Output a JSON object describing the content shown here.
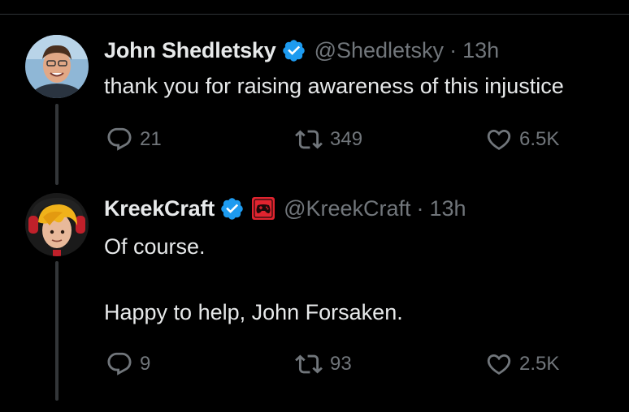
{
  "colors": {
    "background": "#000000",
    "primary_text": "#e7e9ea",
    "secondary_text": "#71767b",
    "verified_blue": "#1d9bf0",
    "thread_line": "#333639",
    "affiliate_badge_red": "#e0242f"
  },
  "tweets": [
    {
      "display_name": "John Shedletsky",
      "verified_icon": "verified-badge-icon",
      "handle": "@Shedletsky",
      "separator": "·",
      "time": "13h",
      "text_lines": [
        "thank you for raising awareness of this injustice"
      ],
      "actions": {
        "replies": "21",
        "retweets": "349",
        "likes": "6.5K"
      }
    },
    {
      "display_name": "KreekCraft",
      "verified_icon": "verified-badge-icon",
      "affiliate_icon": "gamepad-icon",
      "handle": "@KreekCraft",
      "separator": "·",
      "time": "13h",
      "text_lines": [
        "Of course.",
        "Happy to help, John Forsaken."
      ],
      "actions": {
        "replies": "9",
        "retweets": "93",
        "likes": "2.5K"
      }
    }
  ]
}
